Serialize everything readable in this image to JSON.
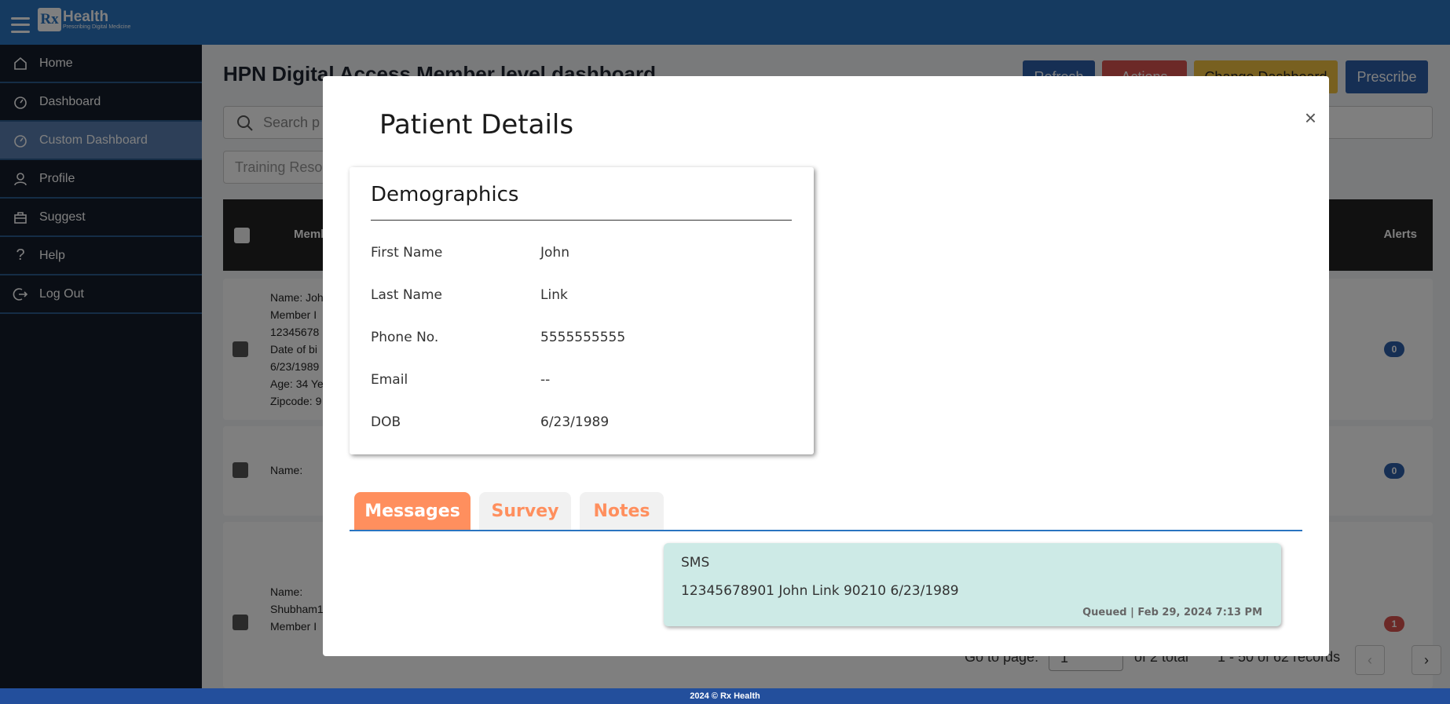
{
  "app": {
    "brand_prefix": "Rx",
    "brand_name": "Health",
    "tagline": "Prescribing Digital Medicine"
  },
  "sidebar": {
    "items": [
      {
        "label": "Home",
        "icon": "home-icon"
      },
      {
        "label": "Dashboard",
        "icon": "dashboard-icon"
      },
      {
        "label": "Custom Dashboard",
        "icon": "dashboard-icon",
        "active": true
      },
      {
        "label": "Profile",
        "icon": "user-icon"
      },
      {
        "label": "Suggest",
        "icon": "suggest-icon"
      },
      {
        "label": "Help",
        "icon": "help-icon"
      },
      {
        "label": "Log Out",
        "icon": "logout-icon"
      }
    ]
  },
  "page": {
    "title": "HPN Digital Access Member level dashboard",
    "buttons": {
      "refresh": "Refresh",
      "actions": "Actions",
      "change_dashboard": "Change Dashboard",
      "prescribe": "Prescribe"
    },
    "search_placeholder": "Search p",
    "training_placeholder": "Training Reso",
    "table": {
      "col_member": "Memb",
      "col_alerts": "Alerts"
    },
    "rows": [
      {
        "lines": [
          "Name: Joh",
          "Member I",
          "12345678",
          "Date of bi",
          "6/23/1989",
          "Age: 34 Ye",
          "Zipcode: 9"
        ],
        "badge": "0"
      },
      {
        "lines": [
          "Name:"
        ],
        "badge": "0"
      },
      {
        "lines": [
          "Name:",
          "Shubham1",
          "Member I"
        ],
        "badge": "1"
      }
    ],
    "pager": {
      "go_to_page": "Go to page:",
      "page_value": "1",
      "of_total": "of 2 total",
      "records": "1 - 50 of 62 records"
    }
  },
  "modal": {
    "title": "Patient Details",
    "close": "×",
    "demographics": {
      "title": "Demographics",
      "fields": [
        {
          "label": "First Name",
          "value": "John"
        },
        {
          "label": "Last Name",
          "value": "Link"
        },
        {
          "label": "Phone No.",
          "value": "5555555555"
        },
        {
          "label": "Email",
          "value": "--"
        },
        {
          "label": "DOB",
          "value": "6/23/1989"
        }
      ]
    },
    "tabs": [
      {
        "label": "Messages",
        "active": true
      },
      {
        "label": "Survey",
        "active": false
      },
      {
        "label": "Notes",
        "active": false
      }
    ],
    "message": {
      "type": "SMS",
      "body": "12345678901 John Link 90210 6/23/1989",
      "meta": "Queued | Feb 29, 2024 7:13 PM"
    }
  },
  "footer": {
    "text": "2024 © Rx Health"
  },
  "colors": {
    "topbar": "#2a74c0",
    "sidebar": "#151c2a",
    "tab_accent": "#ff8f5e",
    "message_bg": "#cdeae6"
  }
}
